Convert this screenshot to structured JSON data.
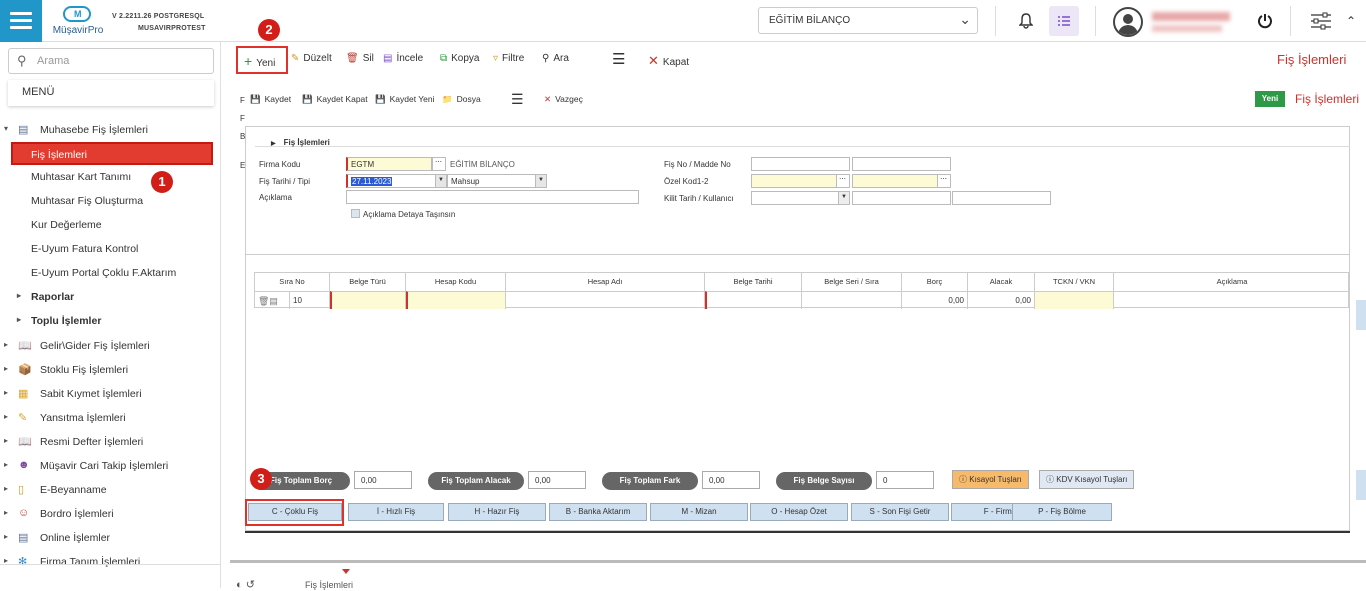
{
  "header": {
    "version": "V 2.2211.26 POSTGRESQL",
    "db": "MUSAVIRPROTEST",
    "logo_text": "MüşavirPro",
    "logo_letter": "M",
    "company_select": "EĞİTİM BİLANÇO",
    "icons": [
      "menu-icon",
      "bell-icon",
      "tasks-icon",
      "user-icon",
      "power-icon",
      "settings-icon",
      "chevron-up-icon"
    ]
  },
  "sidebar": {
    "search_placeholder": "Arama",
    "menu_title": "MENÜ",
    "group_muhasebe": "Muhasebe Fiş İşlemleri",
    "items_muhasebe": [
      "Fiş İşlemleri",
      "Muhtasar Kart Tanımı",
      "Muhtasar Fiş Oluşturma",
      "Kur Değerleme",
      "E-Uyum Fatura Kontrol",
      "E-Uyum Portal Çoklu F.Aktarım"
    ],
    "sub_groups": [
      "Raporlar",
      "Toplu İşlemler"
    ],
    "groups": [
      "Gelir\\Gider Fiş İşlemleri",
      "Stoklu Fiş İşlemleri",
      "Sabit Kıymet İşlemleri",
      "Yansıtma İşlemleri",
      "Resmi Defter İşlemleri",
      "Müşavir Cari Takip İşlemleri",
      "E-Beyanname",
      "Bordro İşlemleri",
      "Online İşlemler",
      "Firma Tanım İşlemleri"
    ]
  },
  "toolbar": {
    "new": "Yeni",
    "edit": "Düzelt",
    "delete": "Sil",
    "inspect": "İncele",
    "copy": "Kopya",
    "filter": "Filtre",
    "find": "Ara",
    "close": "Kapat",
    "page_title": "Fiş İşlemleri"
  },
  "form_toolbar": {
    "save": "Kaydet",
    "save_close": "Kaydet Kapat",
    "save_new": "Kaydet Yeni",
    "file": "Dosya",
    "cancel": "Vazgeç",
    "mode_badge": "Yeni",
    "title": "Fiş İşlemleri"
  },
  "form": {
    "section": "Fiş İşlemleri",
    "firma_kodu_label": "Firma Kodu",
    "firma_kodu_value": "EGTM",
    "firma_name": "EĞİTİM BİLANÇO",
    "fis_tarihi_label": "Fiş Tarihi / Tipi",
    "fis_tarihi_value": "27.11.2023",
    "fis_tipi_value": "Mahsup",
    "aciklama_label": "Açıklama",
    "aciklama_check": "Açıklama Detaya Taşınsın",
    "fis_no_label": "Fiş No / Madde No",
    "ozel_kod_label": "Özel Kod1-2",
    "kilit_label": "Kilit Tarih / Kullanıcı",
    "left_letters": [
      "F",
      "F",
      "B",
      "E"
    ]
  },
  "grid": {
    "columns": [
      "Sıra No",
      "Belge Türü",
      "Hesap Kodu",
      "Hesap Adı",
      "Belge Tarihi",
      "Belge Seri / Sıra",
      "Borç",
      "Alacak",
      "TCKN / VKN",
      "Açıklama"
    ],
    "row": {
      "sira": "10",
      "borc": "0,00",
      "alacak": "0,00"
    }
  },
  "totals": {
    "borc_label": "Fiş Toplam Borç",
    "borc": "0,00",
    "alacak_label": "Fiş Toplam Alacak",
    "alacak": "0,00",
    "fark_label": "Fiş Toplam Fark",
    "fark": "0,00",
    "sayisi_label": "Fiş Belge Sayısı",
    "sayisi": "0",
    "kisayol": "Kısayol Tuşları",
    "kdv_kisayol": "KDV Kısayol Tuşları"
  },
  "shortcuts": [
    "C - Çoklu Fiş",
    "İ - Hızlı Fiş",
    "H - Hazır Fiş",
    "B - Banka Aktarım",
    "M - Mizan",
    "O - Hesap Özet",
    "S - Son Fişi Getir",
    "F - Firma",
    "P - Fiş Bölme"
  ],
  "annotations": [
    "1",
    "2",
    "3"
  ],
  "status": {
    "text": "Fiş İşlemleri"
  }
}
